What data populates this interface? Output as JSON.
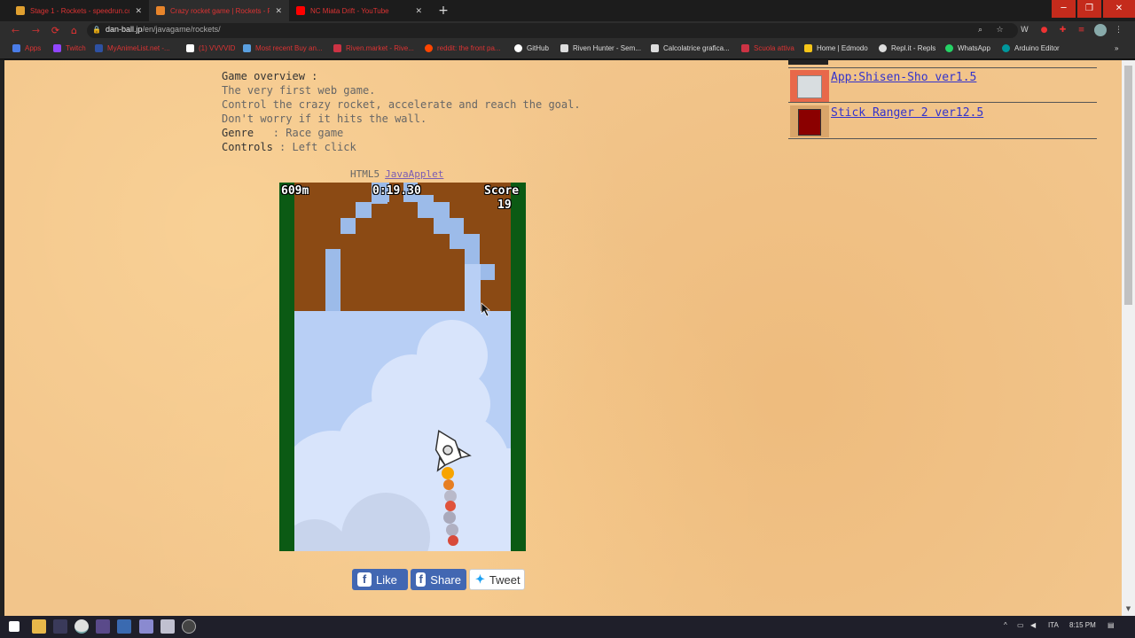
{
  "browser": {
    "tabs": [
      {
        "title": "Stage 1 - Rockets - speedrun.co",
        "favicon_color": "#e0a030",
        "active": false
      },
      {
        "title": "Crazy rocket game | Rockets - F",
        "favicon_color": "#e8852b",
        "active": true
      },
      {
        "title": "NC Miata Drift - YouTube",
        "favicon_color": "#ff0000",
        "active": false
      }
    ],
    "new_tab_label": "+",
    "url_host": "dan-ball.jp",
    "url_path": "/en/javagame/rockets/",
    "window_controls": {
      "minimize": "─",
      "restore": "❐",
      "close": "✕"
    }
  },
  "bookmarks": [
    {
      "label": "Apps",
      "color": "#4a7de8"
    },
    {
      "label": "Twitch",
      "color": "#9146ff"
    },
    {
      "label": "MyAnimeList.net -...",
      "color": "#2e51a2"
    },
    {
      "label": "(1) VVVVID",
      "color": "#ffffff"
    },
    {
      "label": "Most recent Buy an...",
      "color": "#5aa0e0"
    },
    {
      "label": "Riven.market - Rive...",
      "color": "#cc3344"
    },
    {
      "label": "reddit: the front pa...",
      "color": "#ff4500"
    },
    {
      "label": "GitHub",
      "color": "#ffffff"
    },
    {
      "label": "Riven Hunter - Sem...",
      "color": "#dddddd"
    },
    {
      "label": "Calcolatrice grafica...",
      "color": "#dddddd"
    },
    {
      "label": "Scuola attiva",
      "color": "#cc3344"
    },
    {
      "label": "Home | Edmodo",
      "color": "#f5c518"
    },
    {
      "label": "Repl.it - Repls",
      "color": "#dddddd"
    },
    {
      "label": "WhatsApp",
      "color": "#25d366"
    },
    {
      "label": "Arduino Editor",
      "color": "#00979d"
    }
  ],
  "overview": {
    "heading": "Game overview :",
    "lines": [
      "The very first web game.",
      "Control the crazy rocket, accelerate and reach the goal.",
      "Don't worry if it hits the wall."
    ],
    "genre_label": "Genre",
    "genre_value": "   : Race game",
    "controls_label": "Controls",
    "controls_value": " : Left click"
  },
  "modes": {
    "html5": "HTML5",
    "java": "JavaApplet"
  },
  "game": {
    "distance": "609m",
    "timer": "0:19.30",
    "score_label": "Score",
    "score_value": "19",
    "wall_color": "#8b4a14",
    "grass_color": "#0b5a14",
    "sky_color": "#b8cff5"
  },
  "social": {
    "like": "Like",
    "share": "Share",
    "tweet": "Tweet"
  },
  "sidebar": {
    "items": [
      {
        "title": "App:Shisen-Sho ver1.5"
      },
      {
        "title": "Stick Ranger 2 ver12.5"
      }
    ]
  },
  "taskbar": {
    "lang": "ITA",
    "time": "8:15 PM"
  }
}
